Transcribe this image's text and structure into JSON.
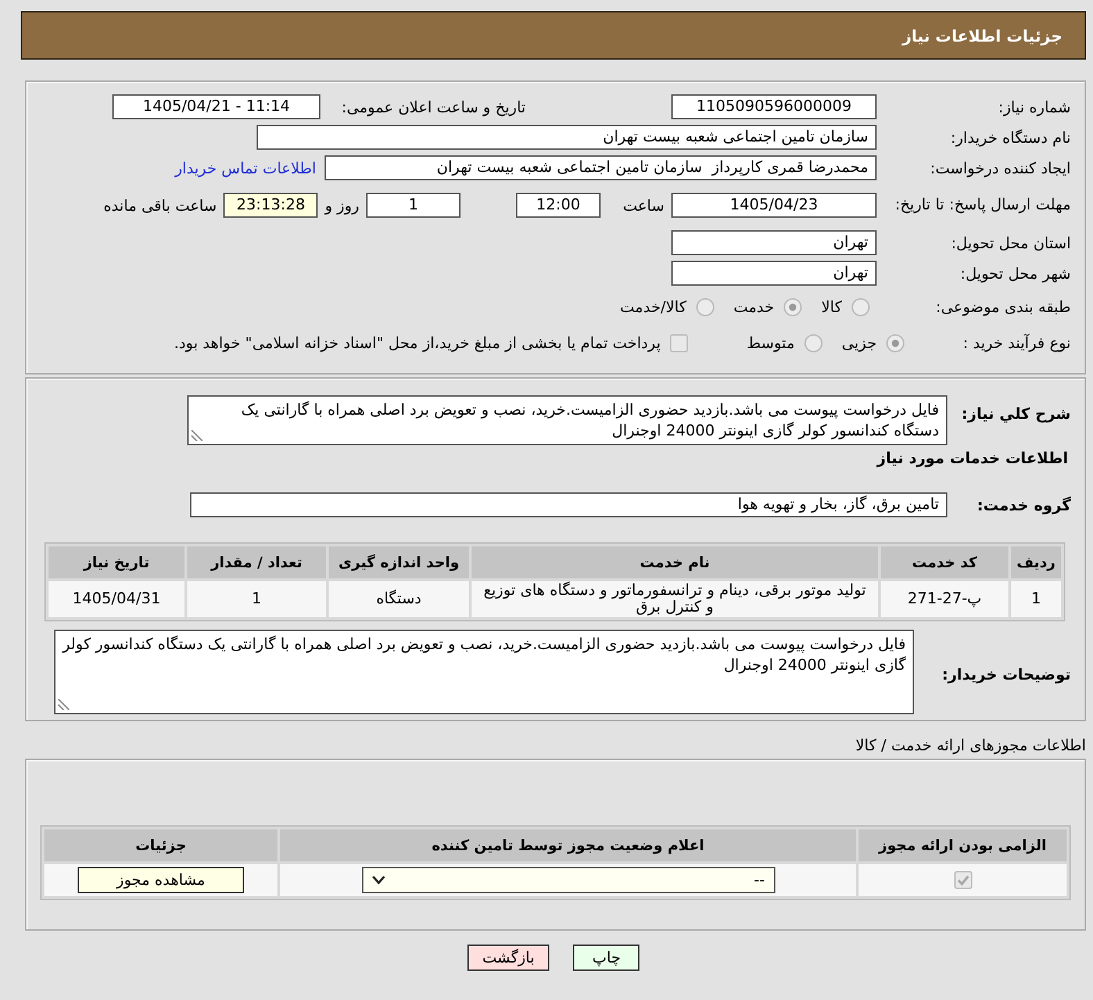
{
  "header": {
    "title": "جزئیات اطلاعات نیاز"
  },
  "general": {
    "need_number": {
      "label": "شماره نیاز:",
      "value": "1105090596000009"
    },
    "announce_datetime": {
      "label": "تاریخ و ساعت اعلان عمومی:",
      "value": "1405/04/21 - 11:14"
    },
    "buyer_org": {
      "label": "نام دستگاه خریدار:",
      "value": "سازمان تامین اجتماعی شعبه بیست تهران"
    },
    "requester": {
      "label": "ایجاد کننده درخواست:",
      "value": "محمدرضا قمری کارپرداز  سازمان تامین اجتماعی شعبه بیست تهران",
      "link": "اطلاعات تماس خریدار"
    },
    "deadline": {
      "label": "مهلت ارسال پاسخ: تا تاریخ:",
      "date": "1405/04/23",
      "time_label": "ساعت",
      "time": "12:00",
      "days": "1",
      "days_label": "روز و",
      "remaining": "23:13:28",
      "remaining_label": "ساعت باقی مانده"
    },
    "province": {
      "label": "استان محل تحویل:",
      "value": "تهران"
    },
    "city": {
      "label": "شهر محل تحویل:",
      "value": "تهران"
    },
    "category": {
      "label": "طبقه بندی موضوعی:",
      "disabled": true,
      "options": [
        {
          "label": "کالا",
          "selected": false
        },
        {
          "label": "خدمت",
          "selected": true
        },
        {
          "label": "کالا/خدمت",
          "selected": false
        }
      ]
    },
    "purchase_type": {
      "label": "نوع فرآیند خرید :",
      "disabled": true,
      "options": [
        {
          "label": "جزیی",
          "selected": true
        },
        {
          "label": "متوسط",
          "selected": false
        }
      ],
      "treasury": {
        "label": "پرداخت تمام یا بخشی از مبلغ خرید،از محل \"اسناد خزانه اسلامی\" خواهد بود.",
        "checked": false,
        "disabled": true
      }
    }
  },
  "services": {
    "summary": {
      "label": "شرح کلي نياز:",
      "value": "فایل درخواست پیوست می باشد.بازدید حضوری الزامیست.خرید، نصب و تعویض برد اصلی همراه با گارانتی یک دستگاه کندانسور کولر گازی اینونتر 24000 اوجنرال"
    },
    "title": "اطلاعات خدمات مورد نیاز",
    "service_group": {
      "label": "گروه خدمت:",
      "value": "تامین برق، گاز، بخار و تهویه هوا"
    },
    "table": {
      "columns": [
        "ردیف",
        "کد خدمت",
        "نام خدمت",
        "واحد اندازه گیری",
        "تعداد / مقدار",
        "تاریخ نیاز"
      ],
      "rows": [
        [
          "1",
          "پ-27-271",
          "تولید موتور برقی، دینام و ترانسفورماتور و دستگاه های توزیع و کنترل برق",
          "دستگاه",
          "1",
          "1405/04/31"
        ]
      ]
    },
    "buyer_notes": {
      "label": "توضیحات خریدار:",
      "value": "فایل درخواست پیوست می باشد.بازدید حضوری الزامیست.خرید، نصب و تعویض برد اصلی همراه با گارانتی یک دستگاه کندانسور کولر گازی اینونتر 24000 اوجنرال"
    }
  },
  "permits": {
    "title": "اطلاعات مجوزهای ارائه خدمت / کالا",
    "table": {
      "columns": [
        "الزامی بودن ارائه مجوز",
        "اعلام وضعیت مجوز توسط تامین کننده",
        "جزئیات"
      ],
      "rows": [
        {
          "required": {
            "checked": true,
            "disabled": true
          },
          "status": "--",
          "details": "مشاهده مجوز"
        }
      ]
    }
  },
  "actions": [
    {
      "label": "چاپ",
      "kind": "print"
    },
    {
      "label": "بازگشت",
      "kind": "back"
    }
  ]
}
